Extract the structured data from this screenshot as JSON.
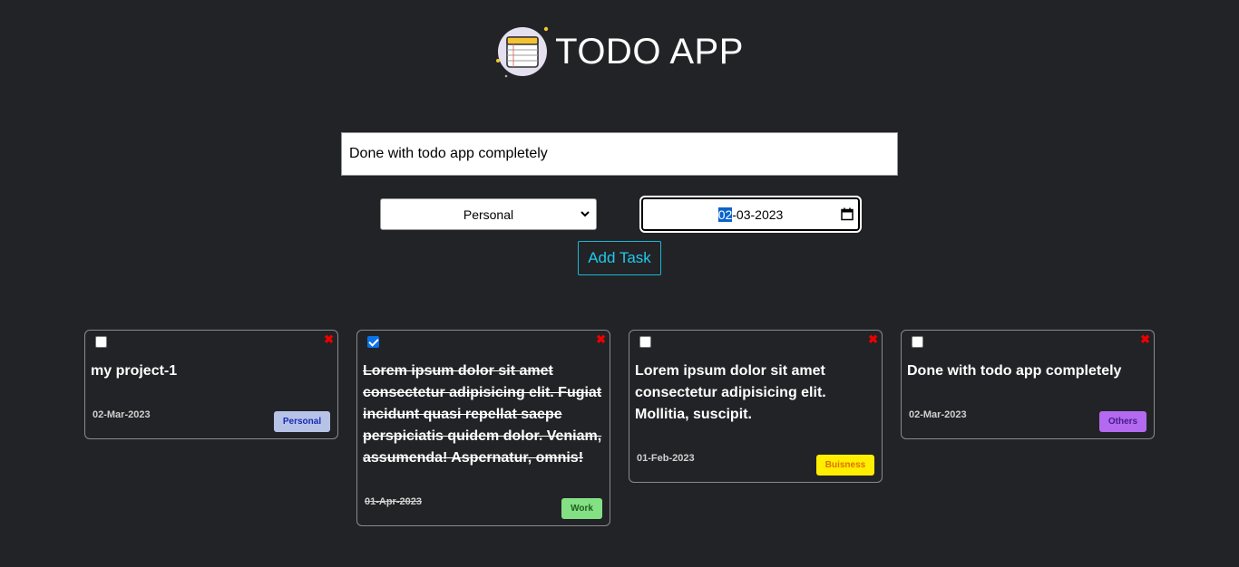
{
  "app": {
    "title": "TODO APP",
    "logo_icon": "notebook-icon"
  },
  "form": {
    "task_value": "Done with todo app completely",
    "category_selected": "Personal",
    "date_parts": {
      "day": "02",
      "rest": "-03-2023"
    },
    "add_button_label": "Add Task"
  },
  "tasks": [
    {
      "text": "my project-1",
      "date": "02-Mar-2023",
      "category": "Personal",
      "done": false,
      "badge_bg": "#b7c3e6",
      "badge_color": "#1a2ab8"
    },
    {
      "text": "Lorem ipsum dolor sit amet consectetur adipisicing elit. Fugiat incidunt quasi repellat saepe perspiciatis quidem dolor. Veniam, assumenda! Aspernatur, omnis!",
      "date": "01-Apr-2023",
      "category": "Work",
      "done": true,
      "badge_bg": "#84e084",
      "badge_color": "#1e5e1e"
    },
    {
      "text": "Lorem ipsum dolor sit amet consectetur adipisicing elit. Mollitia, suscipit.",
      "date": "01-Feb-2023",
      "category": "Buisness",
      "done": false,
      "badge_bg": "#ffee00",
      "badge_color": "#e07000"
    },
    {
      "text": "Done with todo app completely",
      "date": "02-Mar-2023",
      "category": "Others",
      "done": false,
      "badge_bg": "#b36af0",
      "badge_color": "#4a1a8a"
    }
  ],
  "icons": {
    "delete": "✖"
  },
  "colors": {
    "background": "#222326",
    "accent": "#20c8ea",
    "checkbox_checked": "#0b72e8",
    "delete": "#ee0000"
  }
}
